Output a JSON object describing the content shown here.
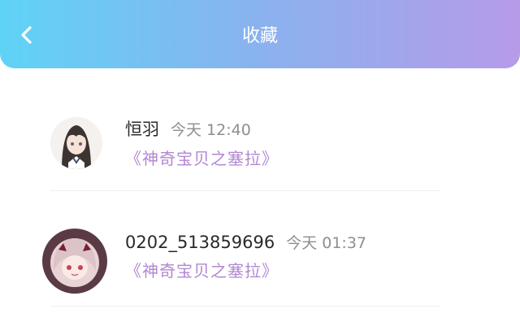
{
  "header": {
    "title": "收藏",
    "back_icon": "chevron-left-icon"
  },
  "items": [
    {
      "name": "恒羽",
      "time": "今天 12:40",
      "link": "《神奇宝贝之塞拉》"
    },
    {
      "name": "0202_513859696",
      "time": "今天 01:37",
      "link": "《神奇宝贝之塞拉》"
    }
  ],
  "colors": {
    "header_gradient_start": "#5fd3f6",
    "header_gradient_end": "#b69be9",
    "link": "#b287d2",
    "time": "#8e8e8e"
  }
}
